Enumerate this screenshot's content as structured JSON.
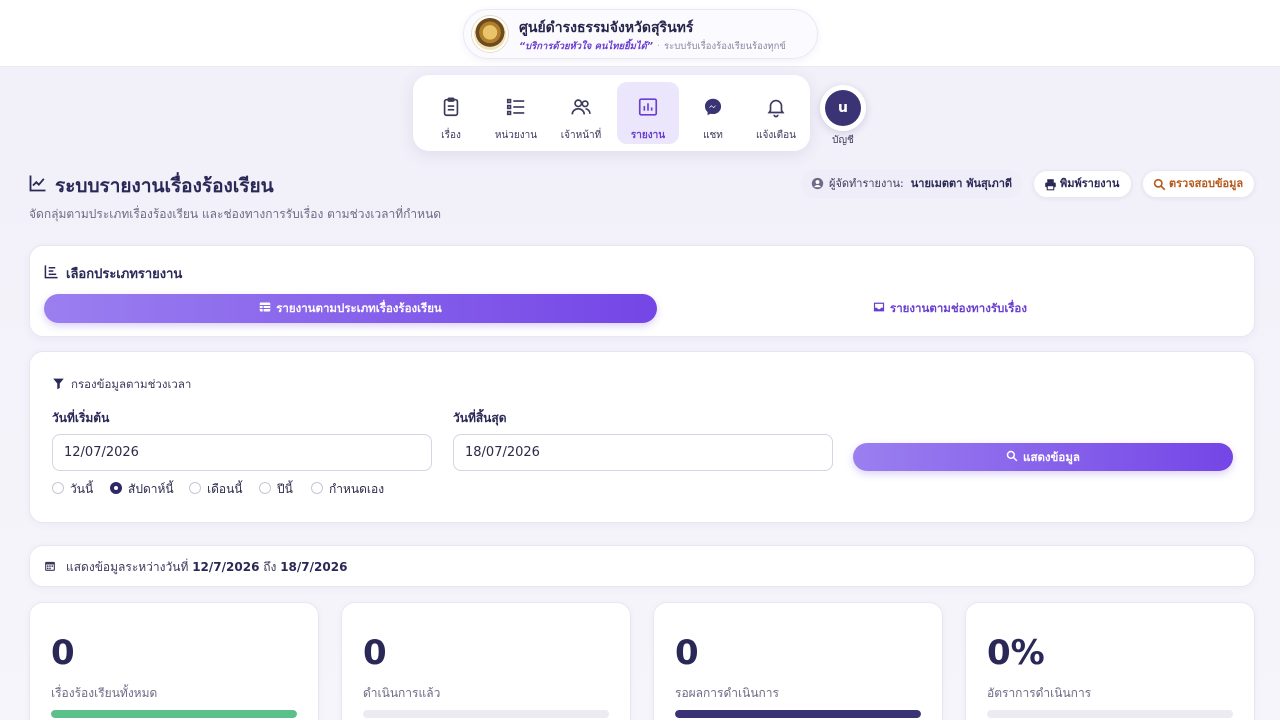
{
  "header": {
    "org_name": "ศูนย์ดำรงธรรมจังหวัดสุรินทร์",
    "slogan": "“บริการด้วยหัวใจ คนไทยยิ้มได้”",
    "separator": "·",
    "system_name": "ระบบรับเรื่องร้องเรียนร้องทุกข์"
  },
  "nav": {
    "items": [
      {
        "label": "เรื่อง",
        "icon": "clipboard-icon"
      },
      {
        "label": "หน่วยงาน",
        "icon": "list-icon"
      },
      {
        "label": "เจ้าหน้าที่",
        "icon": "users-icon"
      },
      {
        "label": "รายงาน",
        "icon": "bar-chart-icon",
        "active": true
      },
      {
        "label": "แชท",
        "icon": "messenger-icon"
      },
      {
        "label": "แจ้งเตือน",
        "icon": "bell-icon"
      }
    ],
    "account": {
      "initial": "u",
      "label": "บัญชี"
    }
  },
  "page": {
    "title": "ระบบรายงานเรื่องร้องเรียน",
    "subtitle": "จัดกลุ่มตามประเภทเรื่องร้องเรียน และช่องทางการรับเรื่อง ตามช่วงเวลาที่กำหนด",
    "reporter_label": "ผู้จัดทำรายงาน:",
    "reporter_name": "นายเมตตา พันสุเภาดี",
    "print_label": "พิมพ์รายงาน",
    "check_label": "ตรวจสอบข้อมูล"
  },
  "report_type": {
    "title": "เลือกประเภทรายงาน",
    "tab_by_type": "รายงานตามประเภทเรื่องร้องเรียน",
    "tab_by_channel": "รายงานตามช่องทางรับเรื่อง"
  },
  "filter": {
    "title": "กรองข้อมูลตามช่วงเวลา",
    "start_label": "วันที่เริ่มต้น",
    "start_value": "12/07/2026",
    "end_label": "วันที่สิ้นสุด",
    "end_value": "18/07/2026",
    "show_button": "แสดงข้อมูล",
    "ranges": [
      {
        "label": "วันนี้",
        "checked": false
      },
      {
        "label": "สัปดาห์นี้",
        "checked": true
      },
      {
        "label": "เดือนนี้",
        "checked": false
      },
      {
        "label": "ปีนี้",
        "checked": false
      },
      {
        "label": "กำหนดเอง",
        "checked": false
      }
    ]
  },
  "range_info": {
    "prefix": "แสดงข้อมูลระหว่างวันที่",
    "start": "12/7/2026",
    "middle": "ถึง",
    "end": "18/7/2026"
  },
  "stats": [
    {
      "value": "0",
      "label": "เรื่องร้องเรียนทั้งหมด",
      "fill": 1.0,
      "color": "#5cc08a"
    },
    {
      "value": "0",
      "label": "ดำเนินการแล้ว",
      "fill": 0.0,
      "color": "#ecebf2"
    },
    {
      "value": "0",
      "label": "รอผลการดำเนินการ",
      "fill": 1.0,
      "color": "#3b3474"
    },
    {
      "value": "0%",
      "label": "อัตราการดำเนินการ",
      "fill": 0.0,
      "color": "#ecebf2"
    }
  ],
  "colors": {
    "accent": "#7446e6",
    "accent_light": "#9b7ff0",
    "navy": "#2a2856",
    "check_orange": "#b5591c"
  }
}
